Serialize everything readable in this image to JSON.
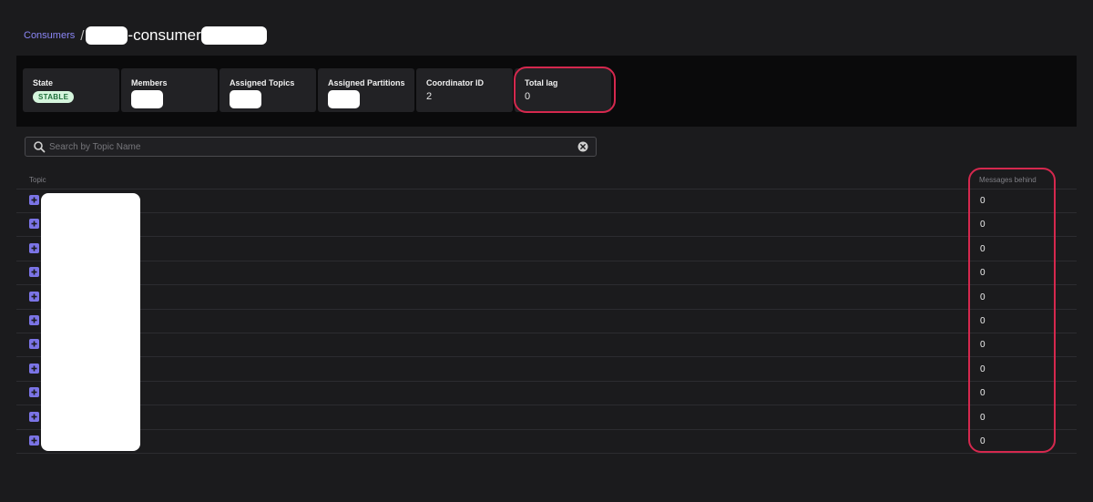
{
  "breadcrumb": {
    "root": "Consumers",
    "separator": "/",
    "title_middle": "-consumer"
  },
  "metrics": {
    "state": {
      "label": "State",
      "value": "STABLE"
    },
    "members": {
      "label": "Members"
    },
    "assigned_topics": {
      "label": "Assigned Topics"
    },
    "assigned_partitions": {
      "label": "Assigned Partitions"
    },
    "coordinator_id": {
      "label": "Coordinator ID",
      "value": "2"
    },
    "total_lag": {
      "label": "Total lag",
      "value": "0"
    }
  },
  "search": {
    "placeholder": "Search by Topic Name",
    "value": ""
  },
  "table": {
    "columns": {
      "topic": "Topic",
      "messages_behind": "Messages behind"
    },
    "rows": [
      {
        "messages_behind": "0"
      },
      {
        "messages_behind": "0"
      },
      {
        "messages_behind": "0"
      },
      {
        "messages_behind": "0"
      },
      {
        "messages_behind": "0"
      },
      {
        "messages_behind": "0"
      },
      {
        "messages_behind": "0"
      },
      {
        "messages_behind": "0"
      },
      {
        "messages_behind": "0"
      },
      {
        "messages_behind": "0"
      },
      {
        "messages_behind": "0"
      }
    ]
  },
  "colors": {
    "accent": "#8b86f5",
    "expand_button": "#7b74e6",
    "highlight": "#d5284e",
    "stable_badge_bg": "#d5f5dd",
    "background": "#1b1b1d"
  },
  "icons": [
    "search-icon",
    "clear-icon",
    "plus-icon"
  ]
}
